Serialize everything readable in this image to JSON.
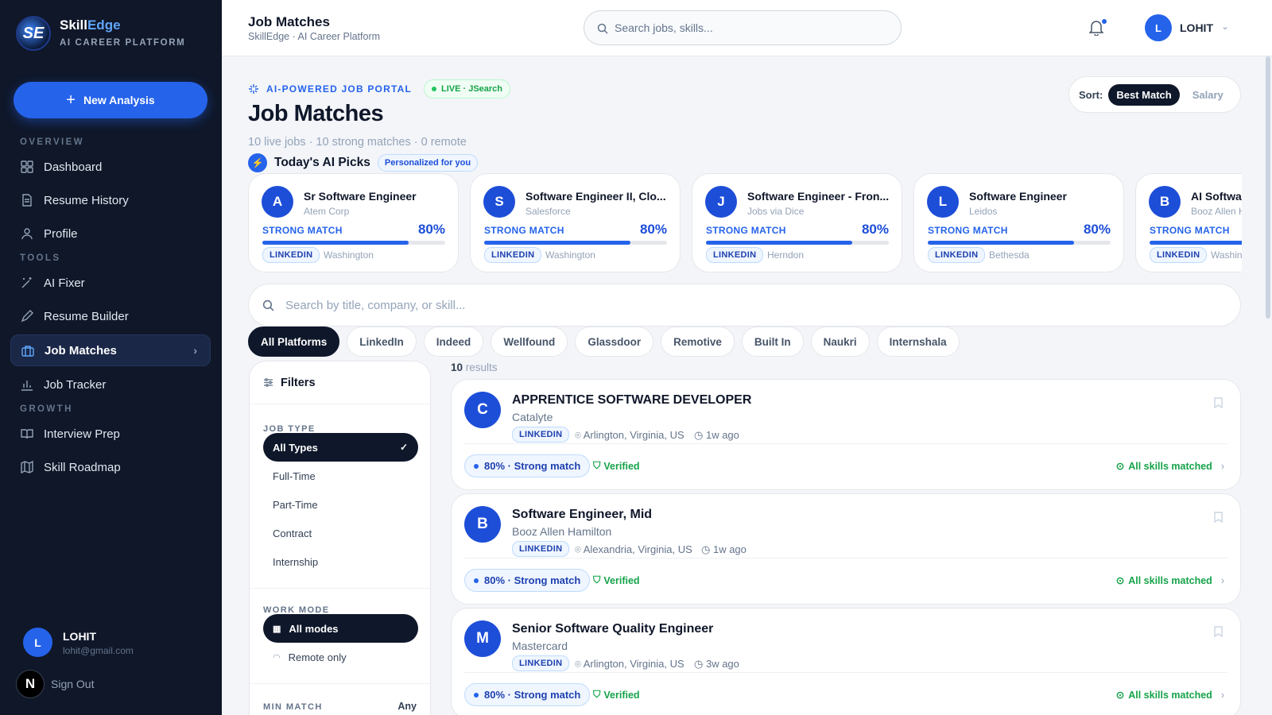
{
  "sidebar": {
    "brand": {
      "name_a": "Skill",
      "name_b": "Edge",
      "tagline": "AI CAREER PLATFORM"
    },
    "new_button": "New Analysis",
    "sections": {
      "overview": "OVERVIEW",
      "tools": "TOOLS",
      "growth": "GROWTH"
    },
    "items": {
      "dashboard": "Dashboard",
      "resume_history": "Resume History",
      "profile": "Profile",
      "ai_fixer": "AI Fixer",
      "resume_builder": "Resume Builder",
      "job_matches": "Job Matches",
      "job_tracker": "Job Tracker",
      "interview_prep": "Interview Prep",
      "skill_roadmap": "Skill Roadmap"
    },
    "user": {
      "initial": "L",
      "name": "LOHIT",
      "email": "lohit@gmail.com"
    },
    "sign_out": "Sign Out",
    "n_badge": "N"
  },
  "topbar": {
    "title": "Job Matches",
    "subtitle": "SkillEdge · AI Career Platform",
    "search_placeholder": "Search jobs, skills...",
    "user_initial": "L",
    "user_name": "LOHIT"
  },
  "page": {
    "kicker": "AI-POWERED JOB PORTAL",
    "live_badge": "LIVE · JSearch",
    "title": "Job Matches",
    "stats": "10 live jobs · 10 strong matches · 0 remote",
    "sort": {
      "label": "Sort:",
      "active": "Best Match",
      "other": "Salary"
    }
  },
  "picks": {
    "title": "Today's AI Picks",
    "badge": "Personalized for you",
    "cards": [
      {
        "initial": "A",
        "title": "Sr Software Engineer",
        "company": "Atem Corp",
        "match_label": "STRONG MATCH",
        "percent": "80%",
        "match": 0.8,
        "source": "LINKEDIN",
        "location": "Washington"
      },
      {
        "initial": "S",
        "title": "Software Engineer II, Clo...",
        "company": "Salesforce",
        "match_label": "STRONG MATCH",
        "percent": "80%",
        "match": 0.8,
        "source": "LINKEDIN",
        "location": "Washington"
      },
      {
        "initial": "J",
        "title": "Software Engineer - Fron...",
        "company": "Jobs via Dice",
        "match_label": "STRONG MATCH",
        "percent": "80%",
        "match": 0.8,
        "source": "LINKEDIN",
        "location": "Herndon"
      },
      {
        "initial": "L",
        "title": "Software Engineer",
        "company": "Leidos",
        "match_label": "STRONG MATCH",
        "percent": "80%",
        "match": 0.8,
        "source": "LINKEDIN",
        "location": "Bethesda"
      },
      {
        "initial": "B",
        "title": "AI Softwa",
        "company": "Booz Allen H",
        "match_label": "STRONG MATCH",
        "percent": "",
        "match": 0.8,
        "source": "LINKEDIN",
        "location": "Washin"
      }
    ]
  },
  "search_jobs": {
    "placeholder": "Search by title, company, or skill..."
  },
  "platforms": [
    "All Platforms",
    "LinkedIn",
    "Indeed",
    "Wellfound",
    "Glassdoor",
    "Remotive",
    "Built In",
    "Naukri",
    "Internshala"
  ],
  "filters": {
    "title": "Filters",
    "job_type_label": "JOB TYPE",
    "job_types": [
      "All Types",
      "Full-Time",
      "Part-Time",
      "Contract",
      "Internship"
    ],
    "work_mode_label": "WORK MODE",
    "work_modes": [
      "All modes",
      "Remote only"
    ],
    "min_match_label": "MIN MATCH",
    "min_match_value": "Any"
  },
  "results": {
    "count": "10",
    "label": "results"
  },
  "jobs": [
    {
      "initial": "C",
      "title": "APPRENTICE SOFTWARE DEVELOPER",
      "company": "Catalyte",
      "source": "LINKEDIN",
      "location": "Arlington, Virginia, US",
      "posted": "1w ago",
      "match": "80% · Strong match",
      "verified": "Verified",
      "skills": "All skills matched"
    },
    {
      "initial": "B",
      "title": "Software Engineer, Mid",
      "company": "Booz Allen Hamilton",
      "source": "LINKEDIN",
      "location": "Alexandria, Virginia, US",
      "posted": "1w ago",
      "match": "80% · Strong match",
      "verified": "Verified",
      "skills": "All skills matched"
    },
    {
      "initial": "M",
      "title": "Senior Software Quality Engineer",
      "company": "Mastercard",
      "source": "LINKEDIN",
      "location": "Arlington, Virginia, US",
      "posted": "3w ago",
      "match": "80% · Strong match",
      "verified": "Verified",
      "skills": "All skills matched"
    }
  ],
  "colors": {
    "accent": "#2563eb",
    "sidebar": "#0f1729",
    "success": "#16a34a"
  }
}
